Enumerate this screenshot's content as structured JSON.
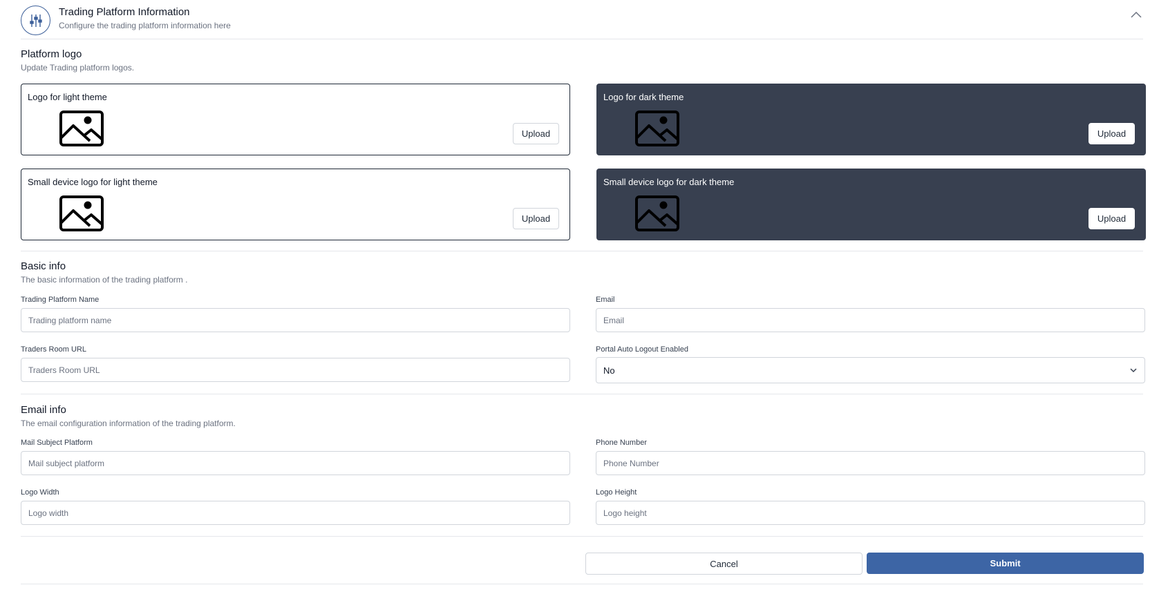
{
  "header": {
    "title": "Trading Platform Information",
    "subtitle": "Configure the trading platform information here",
    "icon": "sliders-icon",
    "collapse_icon": "chevron-up-icon"
  },
  "platform_logo": {
    "title": "Platform logo",
    "subtitle": "Update Trading platform logos.",
    "cards": [
      {
        "label": "Logo for light theme",
        "theme": "light",
        "upload_label": "Upload",
        "icon": "image-icon"
      },
      {
        "label": "Logo for dark theme",
        "theme": "dark",
        "upload_label": "Upload",
        "icon": "image-icon"
      },
      {
        "label": "Small device logo for light theme",
        "theme": "light",
        "upload_label": "Upload",
        "icon": "image-icon"
      },
      {
        "label": "Small device logo for dark theme",
        "theme": "dark",
        "upload_label": "Upload",
        "icon": "image-icon"
      }
    ]
  },
  "basic_info": {
    "title": "Basic info",
    "subtitle": "The basic information of the trading platform .",
    "fields": {
      "platform_name": {
        "label": "Trading Platform Name",
        "placeholder": "Trading platform name",
        "value": ""
      },
      "email": {
        "label": "Email",
        "placeholder": "Email",
        "value": ""
      },
      "traders_room_url": {
        "label": "Traders Room URL",
        "placeholder": "Traders Room URL",
        "value": ""
      },
      "auto_logout": {
        "label": "Portal Auto Logout Enabled",
        "selected": "No"
      }
    }
  },
  "email_info": {
    "title": "Email info",
    "subtitle": "The email configuration information of the trading platform.",
    "fields": {
      "mail_subject": {
        "label": "Mail Subject Platform",
        "placeholder": "Mail subject platform",
        "value": ""
      },
      "phone_number": {
        "label": "Phone Number",
        "placeholder": "Phone Number",
        "value": ""
      },
      "logo_width": {
        "label": "Logo Width",
        "placeholder": "Logo width",
        "value": ""
      },
      "logo_height": {
        "label": "Logo Height",
        "placeholder": "Logo height",
        "value": ""
      }
    }
  },
  "actions": {
    "cancel_label": "Cancel",
    "submit_label": "Submit"
  },
  "colors": {
    "accent": "#3d65a5",
    "dark_card": "#384050",
    "border": "#d1d5db"
  }
}
